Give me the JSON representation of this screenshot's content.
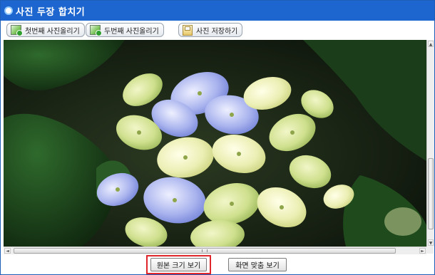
{
  "window": {
    "title": "사진 두장 합치기",
    "accent_color": "#1e66cf",
    "title_icon": "circle-bullet-icon"
  },
  "toolbar": {
    "buttons": [
      {
        "label": "첫번째 사진올리기",
        "icon": "image-upload-icon"
      },
      {
        "label": "두번째 사진올리기",
        "icon": "image-upload-icon"
      },
      {
        "label": "사진 저장하기",
        "icon": "save-icon"
      }
    ]
  },
  "viewer": {
    "content": "hydrangea-photo"
  },
  "scrollbars": {
    "up_arrow": "▲",
    "down_arrow": "▼",
    "left_arrow": "◄",
    "right_arrow": "►"
  },
  "bottom": {
    "original_size_label": "원본 크기 보기",
    "fit_screen_label": "화면 맞춤 보기",
    "highlight_color": "#e0262b"
  }
}
